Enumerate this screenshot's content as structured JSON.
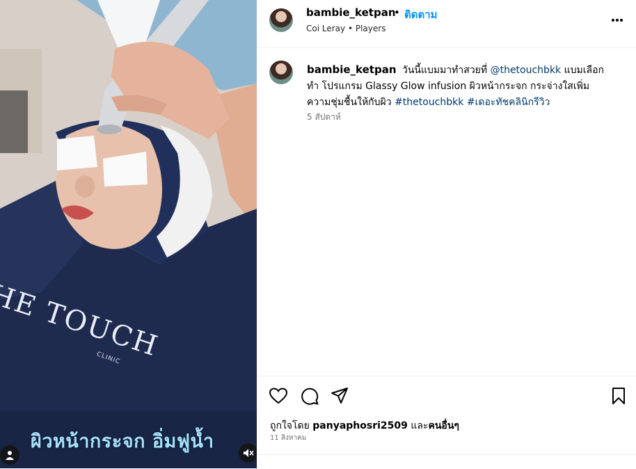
{
  "post": {
    "author": "bambie_ketpan",
    "follow_label": "ติดตาม",
    "separator": "•",
    "music_artist": "Coi Leray",
    "music_separator": "•",
    "music_title": "Players",
    "caption": {
      "username": "bambie_ketpan",
      "text_1": "วันนี้แบมมาทำสวยที่",
      "mention": "@thetouchbkk",
      "text_2": "แบมเลือกทำ โปรแกรม Glassy Glow infusion ผิวหน้ากระจก กระจ่างใสเพิ่มความชุ่มชื้นให้กับผิว",
      "hashtag_1": "#thetouchbkk",
      "hashtag_2": "#เดอะทัชคลินิกรีวิว"
    },
    "time_ago": "5 สัปดาห์",
    "likes_prefix": "ถูกใจโดย",
    "liked_by": "panyaphosri2509",
    "likes_mid": "และ",
    "likes_others": "คนอื่นๆ",
    "date": "11 สิงหาคม"
  },
  "media": {
    "overlay_text": "ผิวหน้ากระจก อิ่มฟูน้ำ",
    "brand_text": "HE TOUCH",
    "brand_sub": "CLINIC"
  },
  "icons": {
    "like": "heart-icon",
    "comment": "speech-bubble-icon",
    "share": "paper-plane-icon",
    "save": "bookmark-icon",
    "more": "three-dots-icon",
    "tag": "person-icon",
    "mute": "speaker-muted-icon"
  },
  "colors": {
    "accent": "#0095f6",
    "link": "#00376b",
    "overlay_text": "#a9e0f5",
    "cape": "#1e2b4f"
  }
}
